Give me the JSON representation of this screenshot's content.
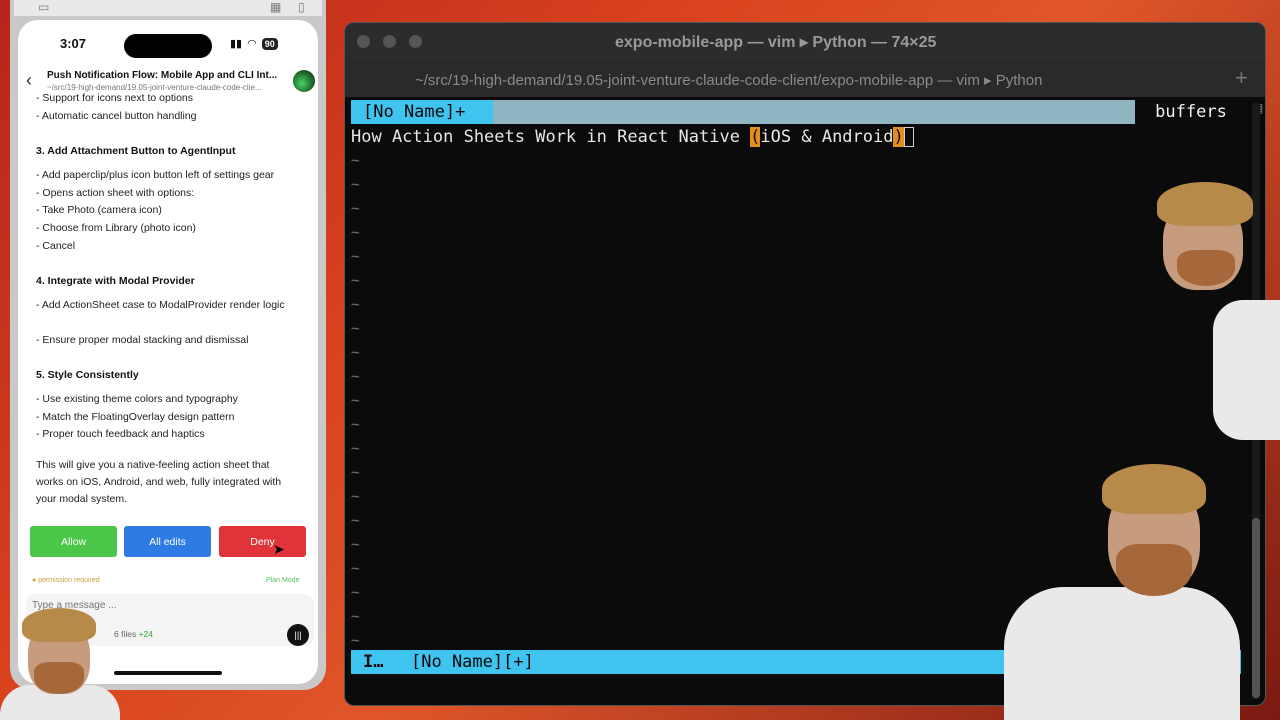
{
  "phone": {
    "time": "3:07",
    "battery": "90",
    "header_title": "Push Notification Flow: Mobile App and CLI Int...",
    "header_path": "~/src/19-high-demand/19.05-joint-venture-claude-code-clie...",
    "lines": [
      {
        "text": "- Support for icons next to options",
        "heading": false
      },
      {
        "text": "- Automatic cancel button handling",
        "heading": false
      },
      {
        "text": "3. Add Attachment Button to AgentInput",
        "heading": true
      },
      {
        "text": "- Add paperclip/plus icon button left of settings gear",
        "heading": false
      },
      {
        "text": "- Opens action sheet with options:",
        "heading": false
      },
      {
        "text": "- Take Photo (camera icon)",
        "heading": false
      },
      {
        "text": "- Choose from Library (photo icon)",
        "heading": false
      },
      {
        "text": "- Cancel",
        "heading": false
      },
      {
        "text": "4. Integrate with Modal Provider",
        "heading": true
      },
      {
        "text": "- Add ActionSheet case to ModalProvider render logic",
        "heading": false
      },
      {
        "text": "- Ensure proper modal stacking and dismissal",
        "heading": false
      },
      {
        "text": "5. Style Consistently",
        "heading": true
      },
      {
        "text": "- Use existing theme colors and typography",
        "heading": false
      },
      {
        "text": "- Match the FloatingOverlay design pattern",
        "heading": false
      },
      {
        "text": "- Proper touch feedback and haptics",
        "heading": false
      },
      {
        "text": "This will give you a native-feeling action sheet that works on iOS, Android, and web, fully integrated with your modal system.",
        "heading": false
      }
    ],
    "buttons": {
      "allow": "Allow",
      "all_edits": "All edits",
      "deny": "Deny"
    },
    "permission_label": "permission required",
    "plan_mode": "Plan Mode",
    "input_placeholder": "Type a message ...",
    "files": "6 files",
    "additions": "+24",
    "status_orb_color": "#49d466"
  },
  "terminal": {
    "window_title": "expo-mobile-app — vim ▸ Python — 74×25",
    "tab_title": "~/src/19-high-demand/19.05-joint-venture-claude-code-client/expo-mobile-app — vim ▸ Python",
    "vim": {
      "tab_name": "[No Name]+",
      "buffers_label": "buffers",
      "line_before": "How Action Sheets Work in React Native ",
      "line_paren_open": "(",
      "line_middle": "iOS & Android",
      "line_paren_close": ")",
      "tilde": "~",
      "mode": "I…",
      "status_buffer": "[No Name][+]"
    },
    "colors": {
      "accent": "#3fc3ef",
      "paren_highlight": "#e48c1e"
    }
  }
}
